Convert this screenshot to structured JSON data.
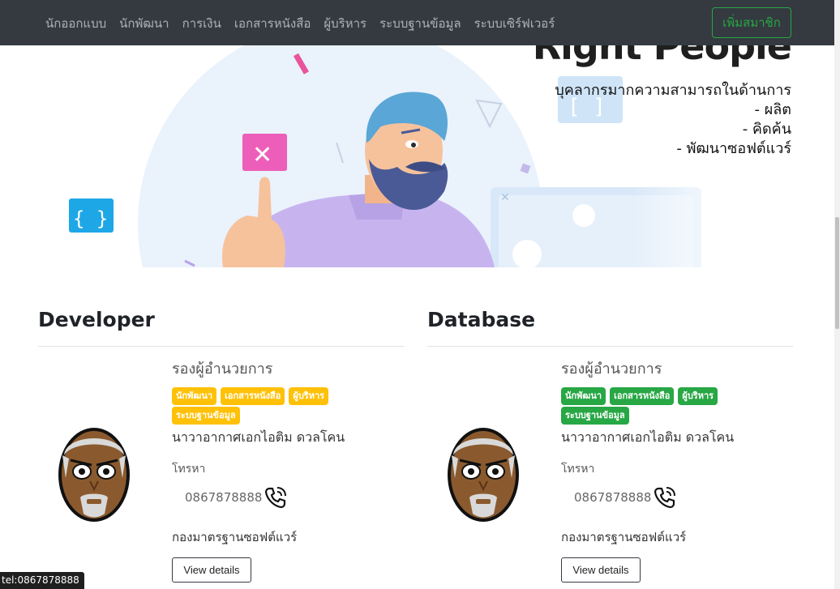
{
  "nav": {
    "links": [
      "นักออกแบบ",
      "นักพัฒนา",
      "การเงิน",
      "เอกสารหนังสือ",
      "ผู้บริหาร",
      "ระบบฐานข้อมูล",
      "ระบบเซิร์ฟเวอร์"
    ],
    "add_member": "เพิ่มสมาชิก"
  },
  "hero": {
    "title": "Right People",
    "lines": [
      "บุคลากรมากความสามารถในด้านการ",
      "- ผลิต",
      "- คิดค้น",
      "- พัฒนาซอฟต์แวร์"
    ],
    "braces_text": "[ ]",
    "braces_text_right": "[ ]"
  },
  "cards": [
    {
      "section": "Developer",
      "role": "รองผู้อำนวยการ",
      "tags": [
        "นักพัฒนา",
        "เอกสารหนังสือ",
        "ผู้บริหาร",
        "ระบบฐานข้อมูล"
      ],
      "tag_color": "yellow",
      "name": "นาวาอากาศเอกไอติม ดวลโคน",
      "tel_label": "โทรหา",
      "phone": "0867878888",
      "dept": "กองมาตรฐานซอฟต์แวร์",
      "button": "View details"
    },
    {
      "section": "Database",
      "role": "รองผู้อำนวยการ",
      "tags": [
        "นักพัฒนา",
        "เอกสารหนังสือ",
        "ผู้บริหาร",
        "ระบบฐานข้อมูล"
      ],
      "tag_color": "green",
      "name": "นาวาอากาศเอกไอติม ดวลโคน",
      "tel_label": "โทรหา",
      "phone": "0867878888",
      "dept": "กองมาตรฐานซอฟต์แวร์",
      "button": "View details"
    }
  ],
  "status_bar": "tel:0867878888",
  "colors": {
    "navbar": "#343a40",
    "success": "#28a745",
    "warning": "#ffc107"
  }
}
